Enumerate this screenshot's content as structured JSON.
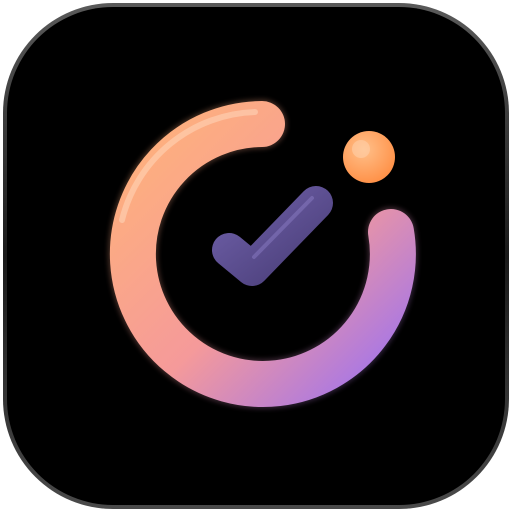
{
  "icon": {
    "name": "timer-check-icon",
    "colors": {
      "tile_background": "#000000",
      "tile_edge": "#4a4a4a",
      "ring_start": "#ffb27a",
      "ring_mid": "#f59a9a",
      "ring_end": "#9e72ef",
      "knob": "#ff9a55",
      "check": "#5b4d8f"
    }
  }
}
